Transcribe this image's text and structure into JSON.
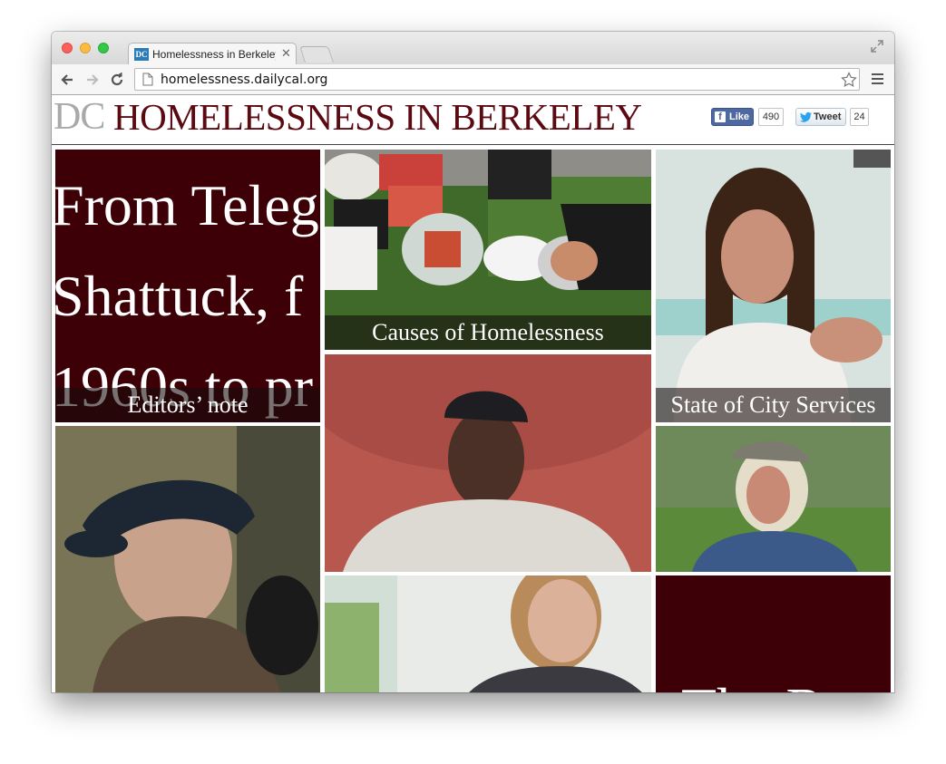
{
  "browser": {
    "tab_title": "Homelessness in Berkeley",
    "tab_favicon": "DC",
    "url": "homelessness.dailycal.org"
  },
  "header": {
    "logo": "DC",
    "title": "HOMELESSNESS IN BERKELEY",
    "facebook_like_label": "Like",
    "facebook_like_count": "490",
    "tweet_label": "Tweet",
    "tweet_count": "24"
  },
  "tiles": {
    "editors_note": {
      "lines": [
        "From Teleg",
        "Shattuck, f",
        "1960s to pr"
      ],
      "caption": "Editors’ note"
    },
    "causes": {
      "caption": "Causes of Homelessness"
    },
    "city_services": {
      "caption": "State of City Services"
    },
    "bottom_right": {
      "text": "The Re"
    }
  },
  "colors": {
    "maroon": "#3e0007",
    "title_red": "#5b0a12",
    "logo_gray": "#a9a9a9"
  }
}
